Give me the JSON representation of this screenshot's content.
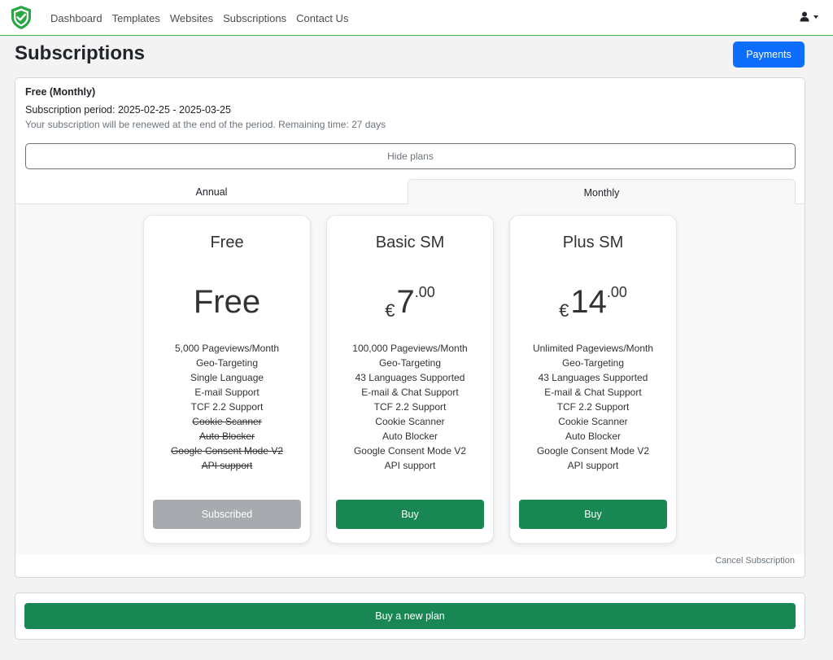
{
  "nav": {
    "logo_icon": "shield-check-icon",
    "links": [
      "Dashboard",
      "Templates",
      "Websites",
      "Subscriptions",
      "Contact Us"
    ],
    "user_icon": "user-icon"
  },
  "header": {
    "title": "Subscriptions",
    "payments_label": "Payments"
  },
  "subscription": {
    "plan_name": "Free (Monthly)",
    "period": "Subscription period: 2025-02-25 - 2025-03-25",
    "renewal": "Your subscription will be renewed at the end of the period. Remaining time: 27 days",
    "hide_plans_label": "Hide plans"
  },
  "tabs": {
    "annual": "Annual",
    "monthly": "Monthly",
    "active": "Monthly"
  },
  "plans": [
    {
      "title": "Free",
      "price_text": "Free",
      "features": [
        "5,000 Pageviews/Month",
        "Geo-Targeting",
        "Single Language",
        "E-mail Support",
        "TCF 2.2 Support",
        "Cookie Scanner",
        "Auto Blocker",
        "Google Consent Mode V2",
        "API support"
      ],
      "button": "Subscribed"
    },
    {
      "title": "Basic SM",
      "currency": "€",
      "price_whole": "7",
      "price_cents": ".00",
      "features": [
        "100,000 Pageviews/Month",
        "Geo-Targeting",
        "43 Languages Supported",
        "E-mail & Chat Support",
        "TCF 2.2 Support",
        "Cookie Scanner",
        "Auto Blocker",
        "Google Consent Mode V2",
        "API support"
      ],
      "button": "Buy"
    },
    {
      "title": "Plus SM",
      "currency": "€",
      "price_whole": "14",
      "price_cents": ".00",
      "features": [
        "Unlimited Pageviews/Month",
        "Geo-Targeting",
        "43 Languages Supported",
        "E-mail & Chat Support",
        "TCF 2.2 Support",
        "Cookie Scanner",
        "Auto Blocker",
        "Google Consent Mode V2",
        "API support"
      ],
      "button": "Buy"
    }
  ],
  "cancel_label": "Cancel Subscription",
  "buy_new_label": "Buy a new plan",
  "colors": {
    "primary": "#0d6efd",
    "success": "#198754",
    "disabled": "#a7abb0",
    "brand": "#28a745"
  }
}
